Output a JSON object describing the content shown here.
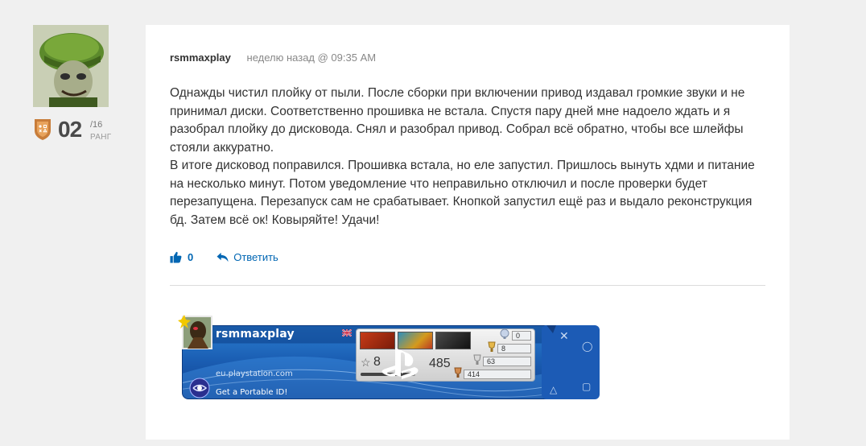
{
  "comment": {
    "author": "rsmmaxplay",
    "time": "неделю назад @ 09:35 AM",
    "rank": {
      "number": "02",
      "of": "/16",
      "label": "РАНГ"
    },
    "paragraphs": [
      "Однажды чистил плойку от пыли. После сборки при включении привод издавал громкие звуки и не принимал диски. Соответственно прошивка не встала. Спустя пару дней мне надоело ждать и я разобрал плойку до дисковода. Снял и разобрал привод. Собрал всё обратно, чтобы все шлейфы стояли аккуратно.",
      "В итоге дисковод поправился. Прошивка встала, но еле запустил. Пришлось вынуть хдми и питание на несколько минут. Потом уведомление что неправильно отключил и после проверки будет перезапущена. Перезапуск сам не срабатывает. Кнопкой запустил ещё раз и выдало реконструкция бд. Затем всё ок! Ковыряйте! Удачи!"
    ],
    "likes": "0",
    "reply_label": "Ответить"
  },
  "psn_card": {
    "username": "rsmmaxplay",
    "url": "eu.playstation.com",
    "cta": "Get a Portable ID!",
    "level": "8",
    "level_progress": 0.95,
    "points": "485",
    "trophies": {
      "platinum": "0",
      "gold": "8",
      "silver": "63",
      "bronze": "414"
    }
  },
  "colors": {
    "link": "#0066b3",
    "psn_blue": "#1b5fb4"
  },
  "icons": {
    "like": "thumbs-up-icon",
    "reply": "reply-arrow-icon",
    "rank": "rank-shield-icon"
  }
}
